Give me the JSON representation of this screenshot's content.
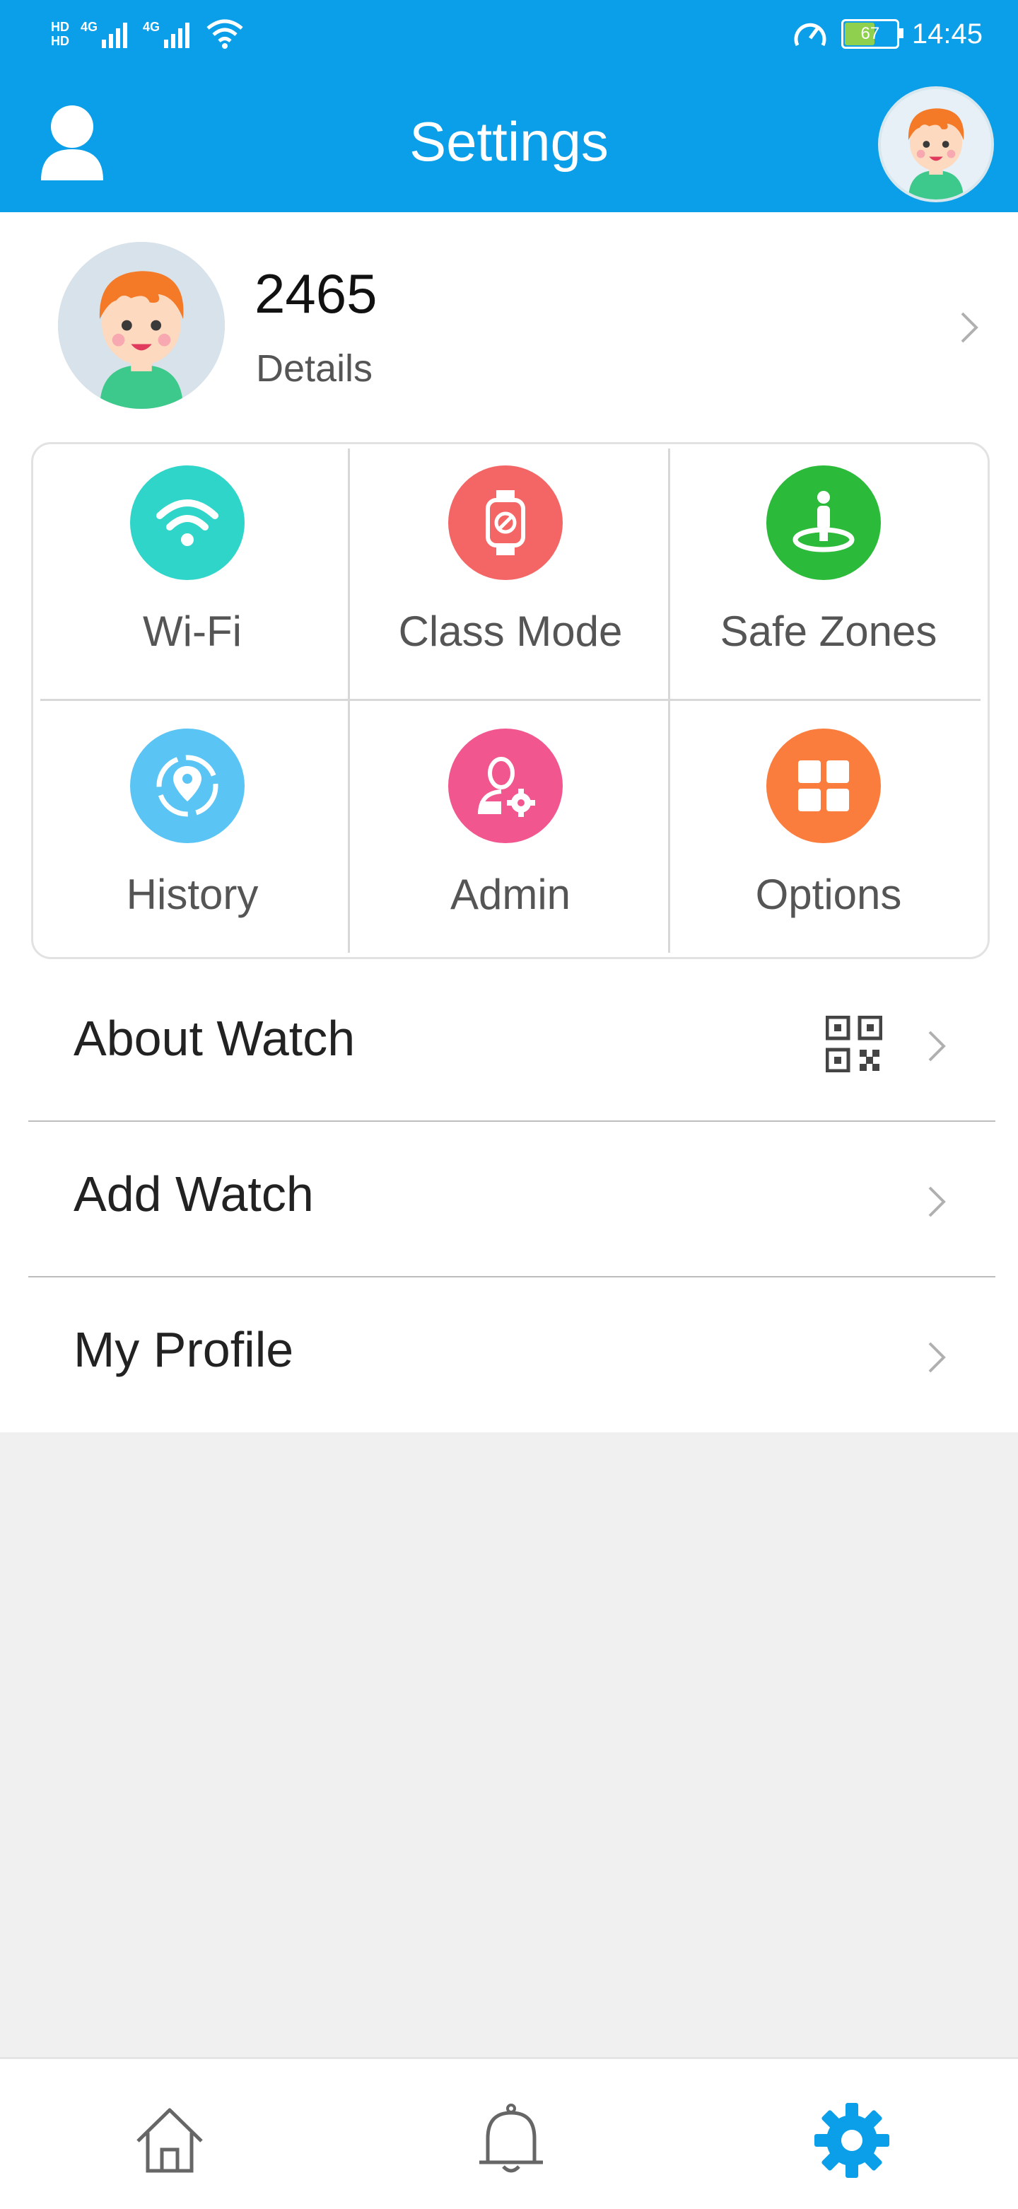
{
  "status_bar": {
    "hd_top": "HD",
    "hd_bottom": "HD",
    "net1": "4G",
    "net2": "4G",
    "battery": "67",
    "time": "14:45"
  },
  "app_bar": {
    "title": "Settings",
    "user_icon": "user-icon",
    "avatar_icon": "boy-avatar-icon"
  },
  "profile": {
    "name": "2465",
    "subtitle": "Details",
    "avatar_icon": "boy-avatar-icon"
  },
  "grid": [
    {
      "label": "Wi-Fi",
      "icon": "wifi-icon",
      "color": "#2fd5c9"
    },
    {
      "label": "Class Mode",
      "icon": "watch-block-icon",
      "color": "#f46565"
    },
    {
      "label": "Safe Zones",
      "icon": "safe-zone-icon",
      "color": "#2cba3a"
    },
    {
      "label": "History",
      "icon": "history-location-icon",
      "color": "#5ac4f5"
    },
    {
      "label": "Admin",
      "icon": "admin-gear-icon",
      "color": "#f1568f"
    },
    {
      "label": "Options",
      "icon": "options-grid-icon",
      "color": "#fb7d3e"
    }
  ],
  "menu": [
    {
      "label": "About Watch",
      "icon": "qr-code-icon"
    },
    {
      "label": "Add Watch"
    },
    {
      "label": "My Profile"
    }
  ],
  "bottom_nav": [
    {
      "name": "home",
      "icon": "home-icon",
      "active": false
    },
    {
      "name": "notifications",
      "icon": "bell-icon",
      "active": false
    },
    {
      "name": "settings",
      "icon": "gear-icon",
      "active": true
    }
  ],
  "colors": {
    "primary": "#0a9fe8",
    "background": "#f0f0f0",
    "card": "#ffffff"
  }
}
